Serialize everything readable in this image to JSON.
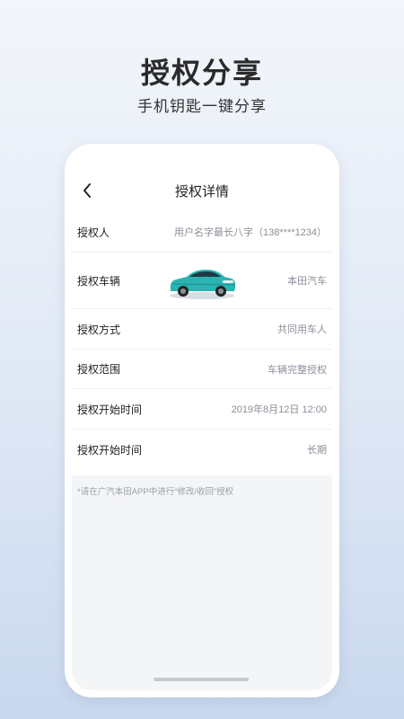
{
  "hero": {
    "title": "授权分享",
    "subtitle": "手机钥匙一键分享"
  },
  "navbar": {
    "title": "授权详情",
    "back_icon": "chevron-left-icon"
  },
  "details": {
    "authorizer": {
      "label": "授权人",
      "value": "用户名字最长八字（138****1234）"
    },
    "vehicle": {
      "label": "授权车辆",
      "value": "本田汽车",
      "image": "car-image"
    },
    "method": {
      "label": "授权方式",
      "value": "共同用车人"
    },
    "scope": {
      "label": "授权范围",
      "value": "车辆完整授权"
    },
    "start_time": {
      "label": "授权开始时间",
      "value": "2019年8月12日  12:00"
    },
    "duration": {
      "label": "授权开始时间",
      "value": "长期"
    }
  },
  "note": "*请在广汽本田APP中进行“修改/收回”授权",
  "colors": {
    "car_body": "#2bb3b1",
    "background_top": "#f3f6fb",
    "background_bottom": "#c9d8ee"
  }
}
